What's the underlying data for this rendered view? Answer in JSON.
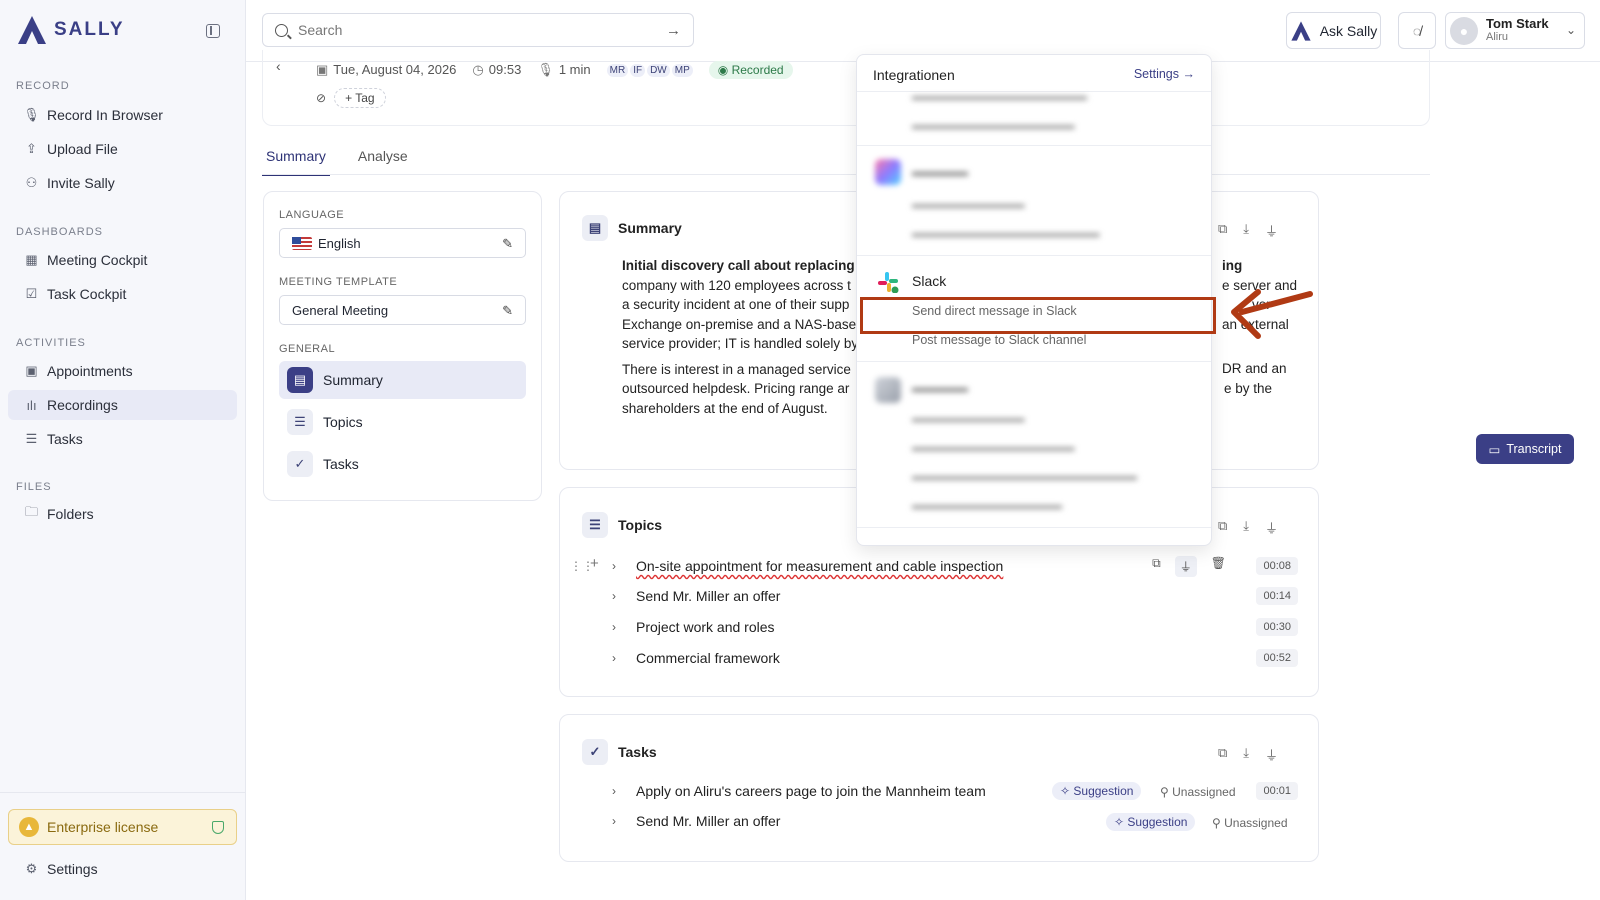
{
  "app": {
    "name": "SALLY"
  },
  "sidebar": {
    "sections": [
      {
        "title": "RECORD",
        "items": [
          {
            "label": "Record In Browser",
            "icon": "mic-icon"
          },
          {
            "label": "Upload File",
            "icon": "upload-icon"
          },
          {
            "label": "Invite Sally",
            "icon": "invite-icon"
          }
        ]
      },
      {
        "title": "DASHBOARDS",
        "items": [
          {
            "label": "Meeting Cockpit",
            "icon": "grid-icon"
          },
          {
            "label": "Task Cockpit",
            "icon": "checkbox-icon"
          }
        ]
      },
      {
        "title": "ACTIVITIES",
        "items": [
          {
            "label": "Appointments",
            "icon": "calendar-icon"
          },
          {
            "label": "Recordings",
            "icon": "waveform-icon",
            "active": true
          },
          {
            "label": "Tasks",
            "icon": "tasks-icon"
          }
        ]
      },
      {
        "title": "FILES",
        "items": [
          {
            "label": "Folders",
            "icon": "folder-icon"
          }
        ]
      }
    ],
    "license": "Enterprise license",
    "settings": "Settings"
  },
  "topbar": {
    "search_placeholder": "Search",
    "ask_label": "Ask Sally",
    "user": {
      "name": "Tom Stark",
      "org": "Aliru"
    }
  },
  "recording": {
    "date": "Tue, August 04, 2026",
    "time": "09:53",
    "duration": "1 min",
    "participants": [
      "MR",
      "IF",
      "DW",
      "MP"
    ],
    "status": "Recorded",
    "tag_label": "Tag"
  },
  "tabs": [
    {
      "label": "Summary",
      "active": true
    },
    {
      "label": "Analyse"
    }
  ],
  "settings_panel": {
    "language_label": "LANGUAGE",
    "language_value": "English",
    "template_label": "MEETING TEMPLATE",
    "template_value": "General Meeting",
    "general_label": "GENERAL",
    "items": [
      "Summary",
      "Topics",
      "Tasks"
    ]
  },
  "summary": {
    "title": "Summary",
    "p1_bold": "Initial discovery call about replacing t",
    "p1_bold_tail": "ing",
    "p1_lines": [
      "company with 120 employees across t",
      "a security incident at one of their supp",
      "Exchange on-premise and a NAS-base",
      "service provider; IT is handled solely by"
    ],
    "p1_tails": [
      "e server and",
      "ver",
      "an external",
      ""
    ],
    "p2_lines": [
      "There is interest in a managed service",
      "outsourced helpdesk. Pricing range ar",
      "shareholders at the end of August."
    ],
    "p2_tails": [
      "DR and an",
      "e by the",
      ""
    ]
  },
  "topics": {
    "title": "Topics",
    "items": [
      {
        "label": "On-site appointment for measurement and cable inspection",
        "time": "00:08"
      },
      {
        "label": "Send Mr. Miller an offer",
        "time": "00:14"
      },
      {
        "label": "Project work and roles",
        "time": "00:30"
      },
      {
        "label": "Commercial framework",
        "time": "00:52"
      }
    ]
  },
  "tasks": {
    "title": "Tasks",
    "items": [
      {
        "label": "Apply on Aliru's careers page to join the Mannheim team",
        "badge": "Suggestion",
        "assignee": "Unassigned",
        "time": "00:01"
      },
      {
        "label": "Send Mr. Miller an offer",
        "badge": "Suggestion",
        "assignee": "Unassigned"
      }
    ]
  },
  "transcript_label": "Transcript",
  "integrations": {
    "title": "Integrationen",
    "settings_label": "Settings",
    "slack": {
      "name": "Slack",
      "items": [
        "Send direct message in Slack",
        "Post message to Slack channel"
      ]
    }
  },
  "colors": {
    "accent": "#3b3f86",
    "highlight": "#b03a14",
    "license_bg": "#fbf3d9"
  }
}
